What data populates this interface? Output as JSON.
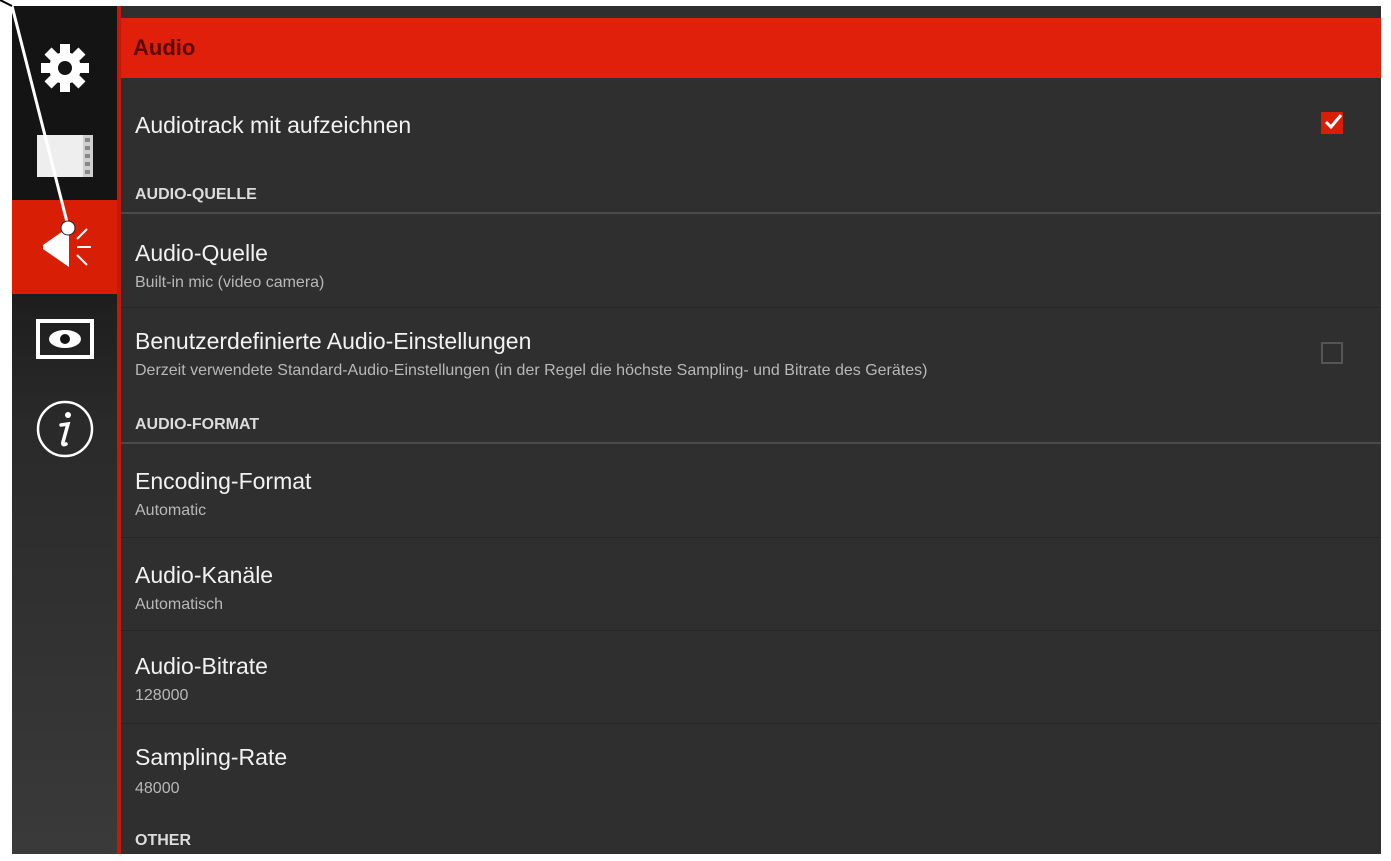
{
  "header": {
    "title": "Audio"
  },
  "sidebar": {
    "items": [
      {
        "icon": "gear-icon"
      },
      {
        "icon": "film-icon"
      },
      {
        "icon": "speaker-icon",
        "active": true
      },
      {
        "icon": "eye-icon"
      },
      {
        "icon": "info-icon"
      }
    ]
  },
  "settings": {
    "record_audio": {
      "title": "Audiotrack mit aufzeichnen",
      "checked": true
    },
    "section_source": "AUDIO-QUELLE",
    "audio_source": {
      "title": "Audio-Quelle",
      "value": "Built-in mic (video camera)"
    },
    "custom_audio": {
      "title": "Benutzerdefinierte Audio-Einstellungen",
      "summary": "Derzeit verwendete Standard-Audio-Einstellungen (in der Regel die höchste Sampling- und Bitrate des Gerätes)",
      "checked": false
    },
    "section_format": "AUDIO-FORMAT",
    "encoding_format": {
      "title": "Encoding-Format",
      "value": "Automatic"
    },
    "audio_channels": {
      "title": "Audio-Kanäle",
      "value": "Automatisch"
    },
    "audio_bitrate": {
      "title": "Audio-Bitrate",
      "value": "128000"
    },
    "sampling_rate": {
      "title": "Sampling-Rate",
      "value": "48000"
    },
    "section_other": "OTHER"
  },
  "colors": {
    "accent": "#e0200a",
    "active_sidebar": "#d81e05",
    "background": "#2f2f2f"
  }
}
